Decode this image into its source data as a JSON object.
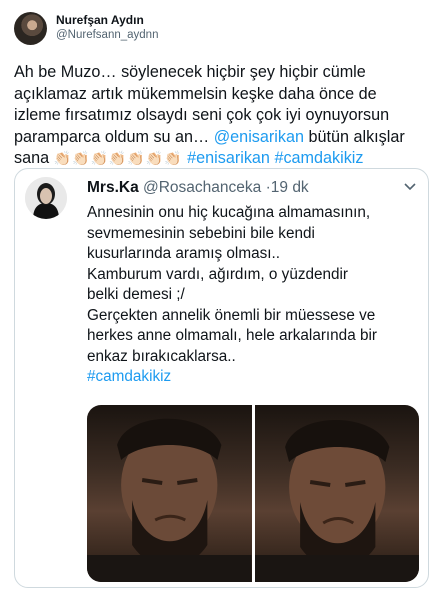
{
  "tweet": {
    "author_name": "Nurefşan Aydın",
    "author_handle": "@Nurefsann_aydnn",
    "text_line1": "Ah be Muzo… söylenecek hiçbir şey hiçbir cümle",
    "text_line2": "açıklamaz artık mükemmelsin keşke daha önce de",
    "text_line3": "izleme fırsatımız olsaydı seni çok çok iyi oynuyorsun",
    "text_line4a": "paramparca oldum su an… ",
    "mention": "@enisarikan",
    "text_line4b": " bütün alkışlar",
    "text_line5a": "sana ",
    "claps": "👏🏻👏🏻👏🏻👏🏻👏🏻👏🏻👏🏻",
    "hashtag1": "#enisarikan",
    "hashtag2": "#camdakikiz"
  },
  "quoted": {
    "author_name": "Mrs.Ka",
    "author_handle": "@Rosachanceka",
    "separator": "·",
    "time": "19 dk",
    "lines": [
      "Annesinin onu hiç kucağına almamasının,",
      "sevmemesinin sebebini bile kendi",
      "kusurlarında aramış olması..",
      "Kamburum vardı, ağırdım, o yüzdendir",
      "belki demesi ;/",
      "Gerçekten annelik önemli bir müessese ve",
      "herkes anne olmamalı, hele arkalarında bir",
      "enkaz bırakıcaklarsa.."
    ],
    "hashtag": "#camdakikiz"
  },
  "colors": {
    "link": "#1d9bf0",
    "muted": "#536471",
    "border": "#cfd9de",
    "text": "#0f1419"
  },
  "icons": {
    "more": "chevron-down-icon"
  }
}
